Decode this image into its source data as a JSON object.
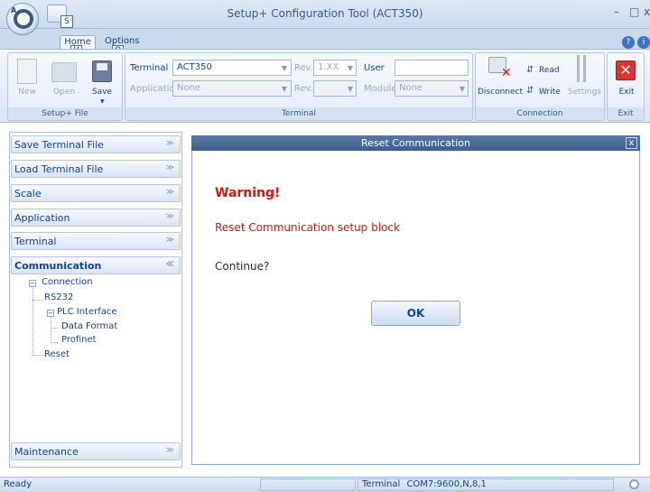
{
  "window": {
    "title": "Setup+ Configuration Tool (ACT350)",
    "minimize": "–",
    "maximize": "□",
    "close": "x"
  },
  "app_button": {
    "glyph": "A",
    "keytip": "S"
  },
  "tabs": [
    {
      "label": "Home",
      "keytip": "H"
    },
    {
      "label": "Options",
      "keytip": "O"
    }
  ],
  "ribbon": {
    "setup_file": {
      "group_label": "Setup+ File",
      "new_label": "New",
      "open_label": "Open",
      "save_label": "Save"
    },
    "terminal": {
      "group_label": "Terminal",
      "terminal_label": "Terminal",
      "terminal_value": "ACT350",
      "rev_label": "Rev.",
      "rev_value": "1.XX",
      "user_label": "User",
      "user_value": "",
      "application_label": "Application",
      "application_value": "None",
      "rev2_label": "Rev.",
      "rev2_value": "",
      "module_label": "Module",
      "module_value": "None"
    },
    "connection": {
      "group_label": "Connection",
      "disconnect_label": "Disconnect",
      "read_label": "Read",
      "write_label": "Write",
      "settings_label": "Settings"
    },
    "exit": {
      "group_label": "Exit",
      "exit_label": "Exit"
    }
  },
  "sidebar": {
    "sections": [
      {
        "label": "Save Terminal File",
        "expanded": false
      },
      {
        "label": "Load Terminal File",
        "expanded": false
      },
      {
        "label": "Scale",
        "expanded": false
      },
      {
        "label": "Application",
        "expanded": false
      },
      {
        "label": "Terminal",
        "expanded": false
      },
      {
        "label": "Communication",
        "expanded": true
      },
      {
        "label": "Maintenance",
        "expanded": false
      }
    ],
    "tree": {
      "connection": "Connection",
      "rs232": "RS232",
      "plc_interface": "PLC Interface",
      "data_format": "Data Format",
      "profinet": "Profinet",
      "reset": "Reset"
    }
  },
  "dialog": {
    "title": "Reset Communication",
    "warning": "Warning!",
    "message": "Reset Communication setup block",
    "question": "Continue?",
    "ok_label": "OK",
    "close": "x"
  },
  "statusbar": {
    "status": "Ready",
    "terminal_label": "Terminal",
    "terminal_info": "COM7:9600,N,8,1"
  },
  "colors": {
    "accent": "#15428b",
    "warning": "#dd1111",
    "dialog_header": "#4a6a98"
  }
}
